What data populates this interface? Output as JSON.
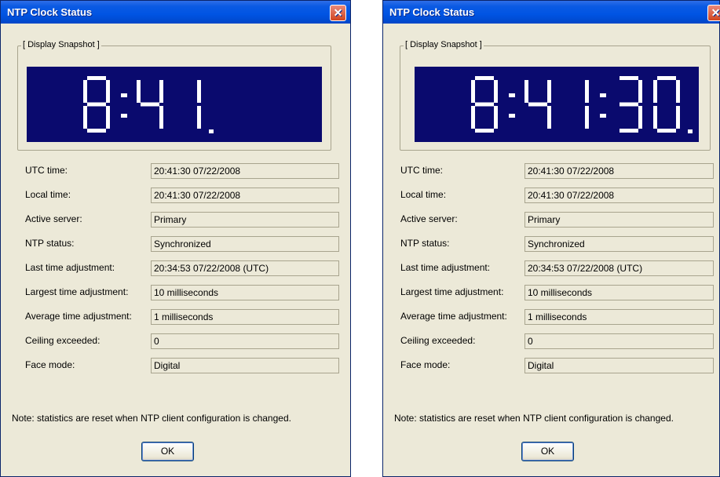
{
  "colors": {
    "titlebar": "#0054e3",
    "dialog_bg": "#ece9d8",
    "display_bg": "#0a0a6e",
    "digit": "#ffffff",
    "close_button": "#d1451f"
  },
  "windows": [
    {
      "title": "NTP Clock Status",
      "group_label": "[ Display Snapshot ]",
      "display_text": "8:41.",
      "rows": [
        {
          "label": "UTC time:",
          "value": "20:41:30 07/22/2008"
        },
        {
          "label": "Local time:",
          "value": "20:41:30 07/22/2008"
        },
        {
          "label": "Active server:",
          "value": "Primary"
        },
        {
          "label": "NTP status:",
          "value": "Synchronized"
        },
        {
          "label": "Last time adjustment:",
          "value": "20:34:53 07/22/2008 (UTC)"
        },
        {
          "label": "Largest time adjustment:",
          "value": "10 milliseconds"
        },
        {
          "label": "Average time adjustment:",
          "value": "1 milliseconds"
        },
        {
          "label": "Ceiling exceeded:",
          "value": "0"
        },
        {
          "label": "Face mode:",
          "value": "Digital"
        }
      ],
      "note": "Note: statistics are reset when NTP client configuration is changed.",
      "ok_label": "OK",
      "close_glyph": "✕"
    },
    {
      "title": "NTP Clock Status",
      "group_label": "[ Display Snapshot ]",
      "display_text": "8:41:30.",
      "rows": [
        {
          "label": "UTC time:",
          "value": "20:41:30 07/22/2008"
        },
        {
          "label": "Local time:",
          "value": "20:41:30 07/22/2008"
        },
        {
          "label": "Active server:",
          "value": "Primary"
        },
        {
          "label": "NTP status:",
          "value": "Synchronized"
        },
        {
          "label": "Last time adjustment:",
          "value": "20:34:53 07/22/2008 (UTC)"
        },
        {
          "label": "Largest time adjustment:",
          "value": "10 milliseconds"
        },
        {
          "label": "Average time adjustment:",
          "value": "1 milliseconds"
        },
        {
          "label": "Ceiling exceeded:",
          "value": "0"
        },
        {
          "label": "Face mode:",
          "value": "Digital"
        }
      ],
      "note": "Note: statistics are reset when NTP client configuration is changed.",
      "ok_label": "OK",
      "close_glyph": "✕"
    }
  ]
}
